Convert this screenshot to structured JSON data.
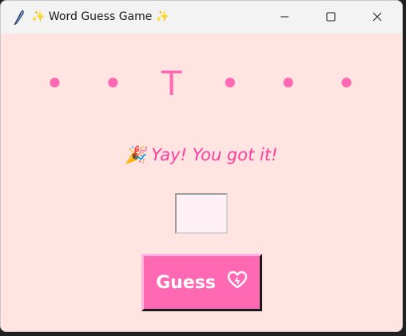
{
  "window": {
    "title": "✨ Word Guess Game ✨",
    "icon": "feather-icon"
  },
  "titlebar": {
    "minimize_icon": "minimize-icon",
    "maximize_icon": "maximize-icon",
    "close_icon": "close-icon"
  },
  "game": {
    "word_display": "•   •   T   •   •   •",
    "message": "🎉 Yay! You got it!",
    "guess_input_value": "",
    "guess_button_label": "Guess",
    "guess_button_icon": "heart-icon"
  },
  "colors": {
    "background": "#ffe4e1",
    "accent": "#ff69b4",
    "message": "#ff3d9e",
    "entry_bg": "#fff0f5"
  }
}
